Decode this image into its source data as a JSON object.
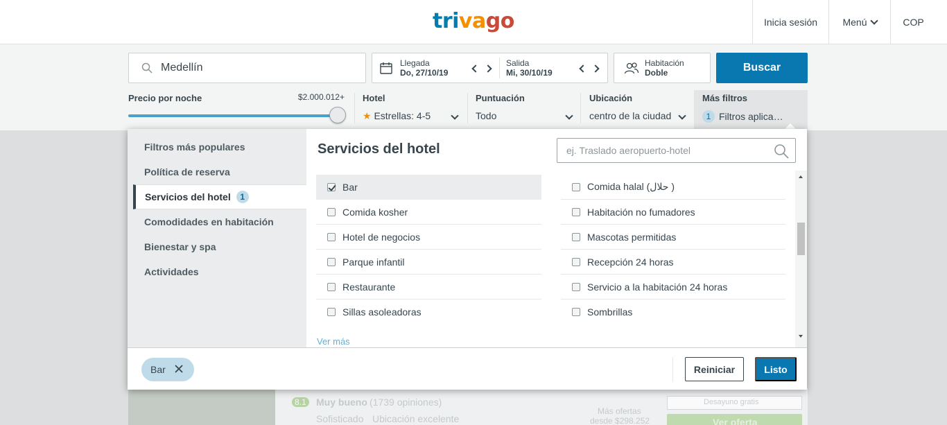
{
  "header": {
    "logo": {
      "part1": "tri",
      "part2": "va",
      "part3": "go"
    },
    "login": "Inicia sesión",
    "menu": "Menú",
    "currency": "COP"
  },
  "search": {
    "destination": "Medellín",
    "checkin_label": "Llegada",
    "checkin_value": "Do, 27/10/19",
    "checkout_label": "Salida",
    "checkout_value": "Mi, 30/10/19",
    "room_label": "Habitación",
    "room_value": "Doble",
    "search_button": "Buscar"
  },
  "filters": {
    "price_title": "Precio por noche",
    "price_max": "$2.000.012+",
    "price_level_percent": 100,
    "hotel_title": "Hotel",
    "hotel_value": "Estrellas: 4-5",
    "rating_title": "Puntuación",
    "rating_value": "Todo",
    "location_title": "Ubicación",
    "location_value": "centro de la ciudad",
    "more_title": "Más filtros",
    "more_count": "1",
    "more_value": "Filtros aplica…"
  },
  "popup": {
    "sidebar": [
      {
        "label": "Filtros más populares"
      },
      {
        "label": "Política de reserva"
      },
      {
        "label": "Servicios del hotel",
        "badge": "1"
      },
      {
        "label": "Comodidades en habitación"
      },
      {
        "label": "Bienestar y spa"
      },
      {
        "label": "Actividades"
      }
    ],
    "title": "Servicios del hotel",
    "search_placeholder": "ej. Traslado aeropuerto-hotel",
    "options_col1": [
      {
        "label": "Bar",
        "checked": true
      },
      {
        "label": "Comida kosher",
        "checked": false
      },
      {
        "label": "Hotel de negocios",
        "checked": false
      },
      {
        "label": "Parque infantil",
        "checked": false
      },
      {
        "label": "Restaurante",
        "checked": false
      },
      {
        "label": "Sillas asoleadoras",
        "checked": false
      }
    ],
    "options_col2": [
      {
        "label": "Comida halal (حلال )",
        "checked": false
      },
      {
        "label": "Habitación no fumadores",
        "checked": false
      },
      {
        "label": "Mascotas permitidas",
        "checked": false
      },
      {
        "label": "Recepción 24 horas",
        "checked": false
      },
      {
        "label": "Servicio a la habitación 24 horas",
        "checked": false
      },
      {
        "label": "Sombrillas",
        "checked": false
      }
    ],
    "see_more": "Ver más",
    "chip": "Bar",
    "reset_button": "Reiniciar",
    "done_button": "Listo"
  },
  "underlay": {
    "rating_badge": "8.1",
    "rating_text": "Muy bueno",
    "reviews": "(1739 opiniones)",
    "tag1": "Sofisticado",
    "tag2": "Ubicación excelente",
    "more_offers": "Más ofertas",
    "from_price": "desde $298.252",
    "breakfast": "Desayuno gratis",
    "deal_button": "Ver oferta"
  },
  "colors": {
    "brand_blue": "#0a78b0",
    "chip_bg": "#bfdbe9",
    "star": "#f48f00"
  }
}
